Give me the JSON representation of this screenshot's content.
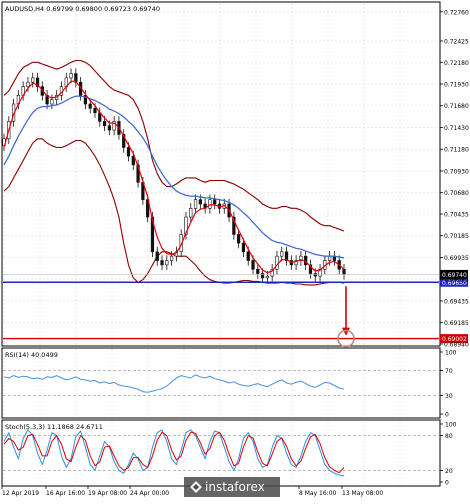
{
  "colors": {
    "background": "#ffffff",
    "grid": "#dcdcdc",
    "axis": "#000000",
    "candle": "#111111",
    "bollinger": "#8b0000",
    "ema_fast": "#e8000b",
    "ema_slow": "#3a6fd8",
    "support": "#1f24c8",
    "target": "#d40000",
    "arrow": "#d40000",
    "circle": "#c08a7a",
    "rsi_line": "#4a8fe0",
    "stoch_main": "#2c8fe3",
    "stoch_signal": "#e00000",
    "price_box": "#000000",
    "support_box": "#1f24c8",
    "target_box": "#d40000",
    "watermark_bg": "#4a4a4a"
  },
  "chart_data": [
    {
      "type": "candlestick",
      "title": "AUDUSD,H4  0.69799 0.69800 0.69723 0.69740",
      "ylim": [
        0.6894,
        0.7285
      ],
      "y_ticks": [
        "0.72760",
        "0.72425",
        "0.72180",
        "0.71930",
        "0.71680",
        "0.71430",
        "0.71180",
        "0.70930",
        "0.70680",
        "0.70435",
        "0.70185",
        "0.69935",
        "0.69685",
        "0.69435",
        "0.69185",
        "0.68940"
      ],
      "current_price": "0.69740",
      "support_level": {
        "value": 0.6965,
        "label": "0.69650"
      },
      "target_level": {
        "value": 0.69002,
        "label": "0.69002"
      },
      "close": [
        0.713,
        0.715,
        0.717,
        0.718,
        0.719,
        0.7195,
        0.72,
        0.719,
        0.718,
        0.717,
        0.7175,
        0.718,
        0.719,
        0.72,
        0.7205,
        0.7195,
        0.718,
        0.717,
        0.7165,
        0.716,
        0.715,
        0.7145,
        0.714,
        0.715,
        0.7135,
        0.712,
        0.711,
        0.71,
        0.708,
        0.706,
        0.704,
        0.7,
        0.699,
        0.6985,
        0.699,
        0.6995,
        0.7,
        0.702,
        0.704,
        0.705,
        0.706,
        0.7055,
        0.705,
        0.706,
        0.7055,
        0.705,
        0.7055,
        0.704,
        0.702,
        0.701,
        0.7,
        0.699,
        0.698,
        0.6975,
        0.697,
        0.6972,
        0.698,
        0.6995,
        0.7,
        0.699,
        0.6985,
        0.699,
        0.6995,
        0.6985,
        0.6975,
        0.6972,
        0.698,
        0.699,
        0.6995,
        0.699,
        0.698,
        0.6974
      ],
      "ema_fast": [
        0.712,
        0.714,
        0.7158,
        0.717,
        0.718,
        0.7188,
        0.7194,
        0.7192,
        0.7186,
        0.7179,
        0.7177,
        0.7178,
        0.7183,
        0.719,
        0.7196,
        0.7196,
        0.7189,
        0.7181,
        0.7174,
        0.7168,
        0.716,
        0.7154,
        0.7148,
        0.7148,
        0.7143,
        0.7133,
        0.7123,
        0.7113,
        0.7098,
        0.7081,
        0.7063,
        0.7036,
        0.7017,
        0.7004,
        0.6998,
        0.6997,
        0.6999,
        0.7008,
        0.7022,
        0.7034,
        0.7045,
        0.7049,
        0.705,
        0.7054,
        0.7054,
        0.7052,
        0.7053,
        0.7048,
        0.7036,
        0.7025,
        0.7014,
        0.7003,
        0.6993,
        0.6986,
        0.6979,
        0.6976,
        0.6978,
        0.6985,
        0.6991,
        0.6991,
        0.6988,
        0.6989,
        0.6991,
        0.6989,
        0.6983,
        0.6978,
        0.6979,
        0.6984,
        0.6988,
        0.6989,
        0.6985,
        0.698
      ],
      "ema_slow": [
        0.71,
        0.711,
        0.7122,
        0.7133,
        0.7143,
        0.7152,
        0.716,
        0.7165,
        0.7167,
        0.7167,
        0.7168,
        0.7169,
        0.7171,
        0.7174,
        0.7177,
        0.7179,
        0.7179,
        0.7178,
        0.7176,
        0.7174,
        0.7171,
        0.7168,
        0.7164,
        0.7162,
        0.7159,
        0.7155,
        0.715,
        0.7145,
        0.7138,
        0.7131,
        0.7122,
        0.711,
        0.7099,
        0.709,
        0.7082,
        0.7075,
        0.707,
        0.7067,
        0.7065,
        0.7064,
        0.7064,
        0.7063,
        0.7062,
        0.7062,
        0.7061,
        0.706,
        0.7059,
        0.7057,
        0.7054,
        0.705,
        0.7045,
        0.704,
        0.7034,
        0.7028,
        0.7022,
        0.7017,
        0.7013,
        0.7011,
        0.701,
        0.7008,
        0.7006,
        0.7004,
        0.7003,
        0.7001,
        0.6999,
        0.6997,
        0.6996,
        0.6995,
        0.6995,
        0.6995,
        0.6994,
        0.6993
      ],
      "bb_upper": [
        0.718,
        0.7185,
        0.7195,
        0.7205,
        0.7212,
        0.7215,
        0.7218,
        0.7218,
        0.7216,
        0.7214,
        0.7212,
        0.721,
        0.7212,
        0.7215,
        0.7218,
        0.722,
        0.722,
        0.7218,
        0.7214,
        0.7208,
        0.7202,
        0.7196,
        0.719,
        0.7186,
        0.7184,
        0.7182,
        0.718,
        0.7175,
        0.7165,
        0.715,
        0.713,
        0.7105,
        0.709,
        0.708,
        0.7075,
        0.7075,
        0.7078,
        0.7082,
        0.7085,
        0.7085,
        0.7085,
        0.7082,
        0.708,
        0.7082,
        0.7082,
        0.7082,
        0.7082,
        0.708,
        0.7078,
        0.7075,
        0.7072,
        0.7068,
        0.7064,
        0.706,
        0.7055,
        0.7052,
        0.705,
        0.705,
        0.7052,
        0.7052,
        0.705,
        0.705,
        0.7048,
        0.7045,
        0.704,
        0.7036,
        0.7032,
        0.703,
        0.703,
        0.7028,
        0.7026,
        0.7024
      ],
      "bb_lower": [
        0.707,
        0.7075,
        0.7085,
        0.7095,
        0.7105,
        0.7115,
        0.7125,
        0.713,
        0.713,
        0.7125,
        0.7122,
        0.712,
        0.712,
        0.7122,
        0.7125,
        0.7128,
        0.7128,
        0.7125,
        0.7118,
        0.711,
        0.71,
        0.7088,
        0.7075,
        0.706,
        0.704,
        0.701,
        0.6985,
        0.697,
        0.6965,
        0.6968,
        0.6975,
        0.6985,
        0.6995,
        0.7,
        0.7,
        0.6998,
        0.6995,
        0.6995,
        0.6995,
        0.699,
        0.6985,
        0.6978,
        0.6972,
        0.6968,
        0.6966,
        0.6965,
        0.6964,
        0.6964,
        0.6965,
        0.6966,
        0.6967,
        0.6967,
        0.6966,
        0.6966,
        0.6965,
        0.6964,
        0.6964,
        0.6964,
        0.6965,
        0.6964,
        0.6964,
        0.6963,
        0.6963,
        0.6962,
        0.6962,
        0.6962,
        0.6963,
        0.6964,
        0.6965,
        0.6965,
        0.6965,
        0.6964
      ]
    },
    {
      "type": "line",
      "title": "RSI(14) 40.0499",
      "ylim": [
        0,
        100
      ],
      "y_ticks": [
        "100",
        "70",
        "30",
        "0"
      ],
      "values": [
        60,
        58,
        62,
        59,
        61,
        60,
        57,
        58,
        56,
        60,
        59,
        62,
        58,
        55,
        57,
        60,
        56,
        55,
        53,
        54,
        50,
        52,
        49,
        51,
        47,
        45,
        44,
        42,
        40,
        36,
        35,
        37,
        39,
        41,
        45,
        52,
        58,
        62,
        60,
        58,
        63,
        60,
        58,
        61,
        57,
        55,
        53,
        50,
        52,
        48,
        46,
        45,
        47,
        49,
        46,
        44,
        48,
        52,
        55,
        50,
        48,
        51,
        53,
        49,
        45,
        43,
        47,
        51,
        50,
        46,
        42,
        40
      ]
    },
    {
      "type": "line",
      "title": "Stoch(5,3,3) 11.1868 24.6711",
      "ylim": [
        0,
        100
      ],
      "y_ticks": [
        "100",
        "80",
        "20",
        "0"
      ],
      "main": [
        70,
        85,
        60,
        40,
        75,
        90,
        80,
        50,
        30,
        55,
        85,
        80,
        45,
        25,
        40,
        78,
        88,
        60,
        30,
        20,
        45,
        70,
        60,
        35,
        20,
        15,
        30,
        50,
        40,
        20,
        25,
        60,
        85,
        90,
        70,
        40,
        30,
        55,
        85,
        90,
        80,
        60,
        40,
        70,
        88,
        85,
        60,
        35,
        20,
        40,
        75,
        85,
        70,
        40,
        25,
        30,
        60,
        80,
        75,
        50,
        30,
        25,
        45,
        70,
        85,
        80,
        55,
        30,
        20,
        15,
        12,
        11
      ],
      "signal": [
        65,
        75,
        70,
        55,
        60,
        80,
        82,
        65,
        45,
        45,
        70,
        80,
        65,
        40,
        35,
        60,
        80,
        72,
        45,
        28,
        35,
        60,
        62,
        45,
        28,
        20,
        25,
        42,
        42,
        30,
        25,
        45,
        72,
        86,
        80,
        55,
        38,
        45,
        72,
        86,
        84,
        68,
        48,
        58,
        80,
        86,
        72,
        48,
        28,
        32,
        60,
        80,
        76,
        52,
        32,
        28,
        48,
        70,
        76,
        62,
        40,
        28,
        36,
        58,
        78,
        82,
        66,
        42,
        26,
        20,
        16,
        25
      ]
    }
  ],
  "x_axis": {
    "labels": [
      "12 Apr 2019",
      "16 Apr 16:00",
      "19 Apr 08:00",
      "24 Apr 00:00",
      "8 May 16:00",
      "13 May 08:00"
    ]
  },
  "watermark": {
    "text": "instaforex"
  }
}
